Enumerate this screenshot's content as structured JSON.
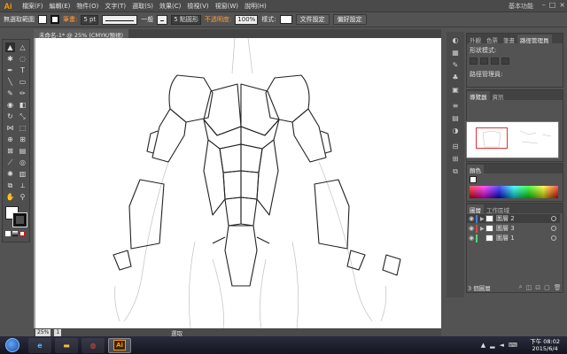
{
  "app": {
    "logo": "Ai"
  },
  "menubar": {
    "items": [
      "檔案(F)",
      "編輯(E)",
      "物件(O)",
      "文字(T)",
      "選取(S)",
      "效果(C)",
      "檢視(V)",
      "視窗(W)",
      "說明(H)"
    ],
    "workspace": "基本功能",
    "window_controls": [
      "–",
      "□",
      "×"
    ]
  },
  "controlbar": {
    "selection_label": "無選取範圍",
    "stroke_label": "筆畫:",
    "stroke_weight": "5 pt",
    "uniform_label": "一般",
    "brush_label": "5 點圓形",
    "opacity_label": "不透明度:",
    "opacity_value": "100%",
    "style_label": "樣式:",
    "doc_setup_btn": "文件設定",
    "prefs_btn": "偏好設定"
  },
  "document": {
    "tab_title": "未命名-1* @ 25% (CMYK/預視)"
  },
  "statusbar": {
    "zoom": "25%",
    "artboard": "1",
    "status": "選取"
  },
  "panels": {
    "appearance": {
      "tabs": [
        "外觀",
        "色票",
        "筆畫",
        "路徑管理員"
      ],
      "row1": "形狀模式:",
      "row2": "路徑管理員:"
    },
    "navigator": {
      "tabs": [
        "導覽器",
        "資訊"
      ]
    },
    "color": {
      "tabs": [
        "顏色"
      ]
    },
    "layers": {
      "tabs": [
        "圖層",
        "工作區域"
      ],
      "items": [
        {
          "name": "圖層 2",
          "color": "#4a7bd8",
          "selected": true
        },
        {
          "name": "圖層 3",
          "color": "#d84a4a",
          "selected": false
        },
        {
          "name": "圖層 1",
          "color": "#4ad87b",
          "selected": false
        }
      ],
      "count": "3 個圖層"
    }
  },
  "taskbar": {
    "ai_label": "Ai",
    "time": "下午 08:02",
    "date": "2015/6/4"
  }
}
